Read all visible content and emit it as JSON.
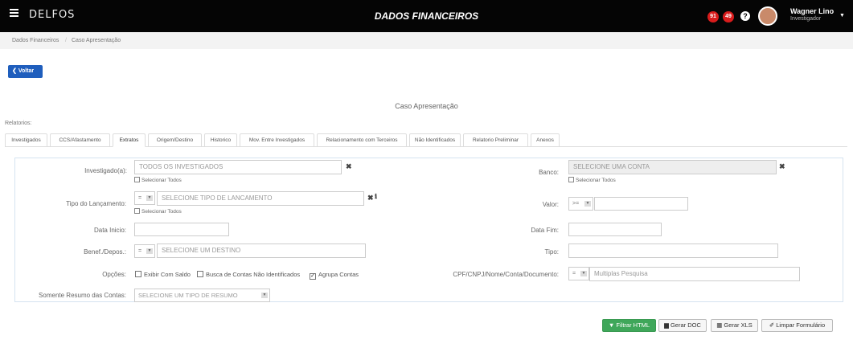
{
  "topbar": {
    "app_title": "DADOS FINANCEIROS",
    "logo": "DELFOS",
    "notif1_count": "91",
    "notif2_count": "49",
    "help": "?",
    "user_name": "Wagner Lino",
    "user_role": "Investigador"
  },
  "breadcrumb": {
    "item1": "Dados Financeiros",
    "sep": "/",
    "item2": "Caso Apresentação"
  },
  "back_label": "Voltar",
  "case_title": "Caso Apresentação",
  "reports_label": "Relatorios:",
  "tabs": [
    "Investigados",
    "CCS/Afastamento",
    "Extratos",
    "Origem/Destino",
    "Historico",
    "Mov. Entre Investigados",
    "Relacionamento com Terceiros",
    "Não Identificados",
    "Relatorio Preliminar",
    "Anexos"
  ],
  "active_tab": "Extratos",
  "form": {
    "investigado_label": "Investigado(a):",
    "investigado_value": "TODOS OS INVESTIGADOS",
    "select_all": "Selecionar Todos",
    "banco_label": "Banco:",
    "banco_value": "SELECIONE UMA CONTA",
    "tipo_lanc_label": "Tipo do Lançamento:",
    "tipo_lanc_op": "=",
    "tipo_lanc_value": "SELECIONE TIPO DE LANCAMENTO",
    "valor_label": "Valor:",
    "valor_op": ">=",
    "valor_value": "",
    "data_inicio_label": "Data Inicio:",
    "data_inicio_value": "",
    "data_fim_label": "Data Fim:",
    "data_fim_value": "",
    "benef_label": "Benef./Depos.:",
    "benef_op": "=",
    "benef_value": "SELECIONE UM DESTINO",
    "tipo_label": "Tipo:",
    "tipo_value": "",
    "opcoes_label": "Opções:",
    "opt_exibir": "Exibir Com Saldo",
    "opt_busca": "Busca de Contas Não Identificados",
    "opt_agrupa": "Agrupa Contas",
    "cpf_label": "CPF/CNPJ/Nome/Conta/Documento:",
    "cpf_op": "=",
    "cpf_placeholder": "Multiplas Pesquisa",
    "resumo_label": "Somente Resumo das Contas:",
    "resumo_value": "SELECIONE UM TIPO DE RESUMO"
  },
  "actions": {
    "filtrar": "Filtrar HTML",
    "gerar_doc": "Gerar DOC",
    "gerar_xls": "Gerar XLS",
    "limpar": "Limpar Formulário"
  },
  "colors": {
    "topbar": "#050505",
    "primary": "#1f5ebd",
    "success": "#3fa75a",
    "badge": "#d91c1c"
  }
}
